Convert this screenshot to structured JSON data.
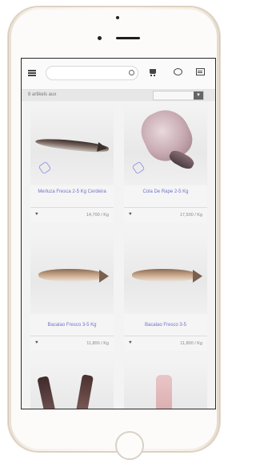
{
  "header": {
    "search_placeholder": ""
  },
  "filter": {
    "results_text": "8 artikels aux",
    "sort_value": ""
  },
  "products": [
    {
      "title": "Merluza Fresca 2-5 Kg Cerdeira",
      "price": "14,700 / Kg"
    },
    {
      "title": "Cola De Rape 2-5 Kg",
      "price": "17,500 / Kg"
    },
    {
      "title": "Bacalao Fresco 3-5 Kg",
      "price": "11,800 / Kg"
    },
    {
      "title": "Bacalao Fresco 3-5",
      "price": "11,800 / Kg"
    },
    {
      "title": "",
      "price": ""
    },
    {
      "title": "",
      "price": ""
    }
  ],
  "icons": {
    "menu": "hamburger-menu-icon",
    "search": "search-icon",
    "cart": "cart-icon",
    "chat": "chat-icon",
    "list": "list-icon",
    "favorite": "heart-icon",
    "badge": "tag-icon"
  }
}
